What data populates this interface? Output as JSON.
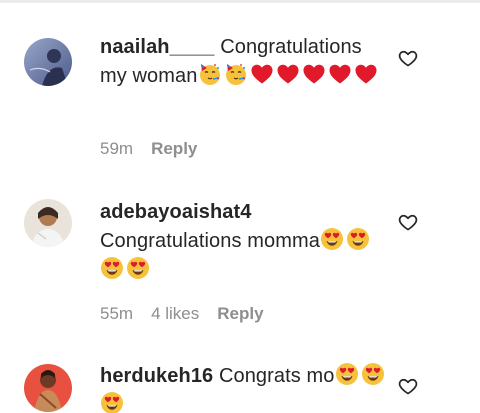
{
  "comments": [
    {
      "username": "naailah____",
      "text": "Congratulations my woman",
      "emoji": [
        "partying-face-emoji",
        "partying-face-emoji",
        "red-heart-emoji",
        "red-heart-emoji",
        "red-heart-emoji",
        "red-heart-emoji",
        "red-heart-emoji"
      ],
      "time": "59m",
      "likes": "",
      "reply_label": "Reply"
    },
    {
      "username": "adebayoaishat4",
      "text": "Congratulations momma",
      "emoji": [
        "heart-eyes-emoji",
        "heart-eyes-emoji",
        "heart-eyes-emoji",
        "heart-eyes-emoji"
      ],
      "time": "55m",
      "likes": "4 likes",
      "reply_label": "Reply"
    },
    {
      "username": "herdukeh16",
      "text": "Congrats mo",
      "emoji": [
        "heart-eyes-emoji",
        "heart-eyes-emoji",
        "heart-eyes-emoji"
      ],
      "time": "",
      "likes": "",
      "reply_label": ""
    }
  ],
  "colors": {
    "text": "#262626",
    "meta": "#8e8e8e",
    "heart_red": "#e0192b",
    "emoji_yellow": "#f7c23b"
  },
  "icons": {
    "like": "heart-outline-icon"
  }
}
